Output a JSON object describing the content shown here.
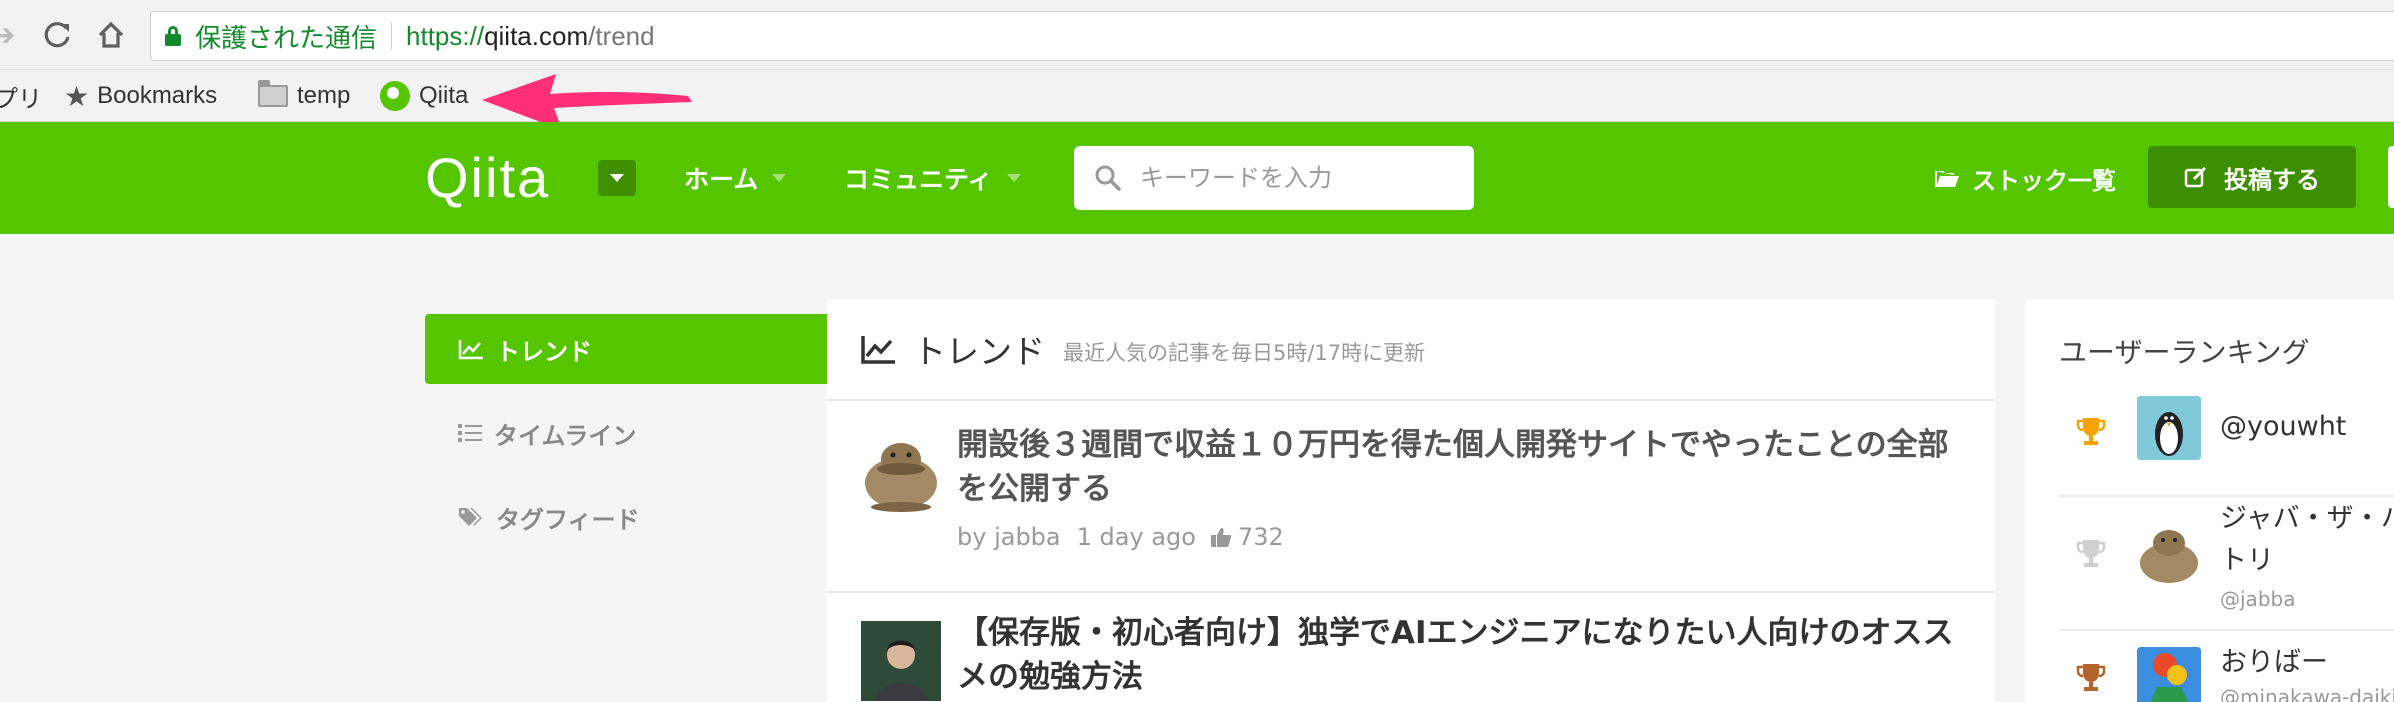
{
  "browser": {
    "secure_label": "保護された通信",
    "url_scheme": "https://",
    "url_host": "qiita.com",
    "url_path": "/trend",
    "bookmarks": [
      {
        "label": "プリ",
        "icon": "apps-icon"
      },
      {
        "label": "Bookmarks",
        "icon": "star-icon"
      },
      {
        "label": "temp",
        "icon": "folder-icon"
      },
      {
        "label": "Qiita",
        "icon": "qiita-favicon"
      }
    ],
    "annotation_color": "#ff2f77"
  },
  "header": {
    "logo": "Qiita",
    "nav": [
      {
        "label": "ホーム"
      },
      {
        "label": "コミュニティ"
      }
    ],
    "search_placeholder": "キーワードを入力",
    "stock_label": "ストック一覧",
    "post_label": "投稿する",
    "brand_color": "#55c500"
  },
  "sidebar": {
    "items": [
      {
        "label": "トレンド",
        "icon": "trend-icon",
        "active": true
      },
      {
        "label": "タイムライン",
        "icon": "list-icon",
        "active": false
      },
      {
        "label": "タグフィード",
        "icon": "tag-icon",
        "active": false
      }
    ]
  },
  "main": {
    "title": "トレンド",
    "subtitle": "最近人気の記事を毎日5時/17時に更新",
    "articles": [
      {
        "title": "開設後３週間で収益１０万円を得た個人開発サイトでやったことの全部を公開する",
        "author": "by jabba",
        "time": "1 day ago",
        "likes": "732"
      },
      {
        "title": "【保存版・初心者向け】独学でAIエンジニアになりたい人向けのオススメの勉強方法",
        "author": "",
        "time": "",
        "likes": ""
      }
    ]
  },
  "ranking": {
    "title": "ユーザーランキング",
    "users": [
      {
        "name": "@youwht",
        "handle": "",
        "trophy": "gold"
      },
      {
        "name": "ジャバ・ザ・ハ",
        "name2": "トリ",
        "handle": "@jabba",
        "trophy": "silver"
      },
      {
        "name": "おりばー",
        "handle": "@minakawa-daiki",
        "trophy": "bronze"
      }
    ]
  }
}
